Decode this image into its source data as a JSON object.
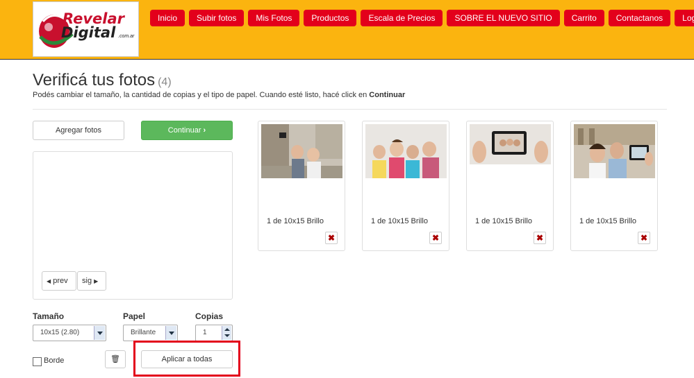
{
  "logo": {
    "line1": "Revelar",
    "line2": "Digital",
    "suffix": ".com.ar"
  },
  "nav": {
    "inicio": "Inicio",
    "subir": "Subir fotos",
    "mis_fotos": "Mis Fotos",
    "productos": "Productos",
    "escala": "Escala de Precios",
    "sobre": "SOBRE EL NUEVO SITIO",
    "carrito": "Carrito",
    "contacto": "Contactanos",
    "login": "Login"
  },
  "page": {
    "title": "Verificá tus fotos",
    "count": "(4)",
    "subtitle": "Podés cambiar el tamaño, la cantidad de copias y el tipo de papel. Cuando esté listo, hacé click en",
    "subtitle_bold": "Continuar"
  },
  "actions": {
    "add": "Agregar fotos",
    "continue": "Continuar"
  },
  "pager": {
    "prev": "prev",
    "next": "sig"
  },
  "options": {
    "size_label": "Tamaño",
    "size_value": "10x15 (2.80)",
    "paper_label": "Papel",
    "paper_value": "Brillante",
    "copies_label": "Copias",
    "copies_value": "1",
    "border_label": "Borde",
    "apply_all": "Aplicar a todas"
  },
  "photos": [
    {
      "caption": "1 de 10x15 Brillo"
    },
    {
      "caption": "1 de 10x15 Brillo"
    },
    {
      "caption": "1 de 10x15 Brillo"
    },
    {
      "caption": "1 de 10x15 Brillo"
    }
  ]
}
